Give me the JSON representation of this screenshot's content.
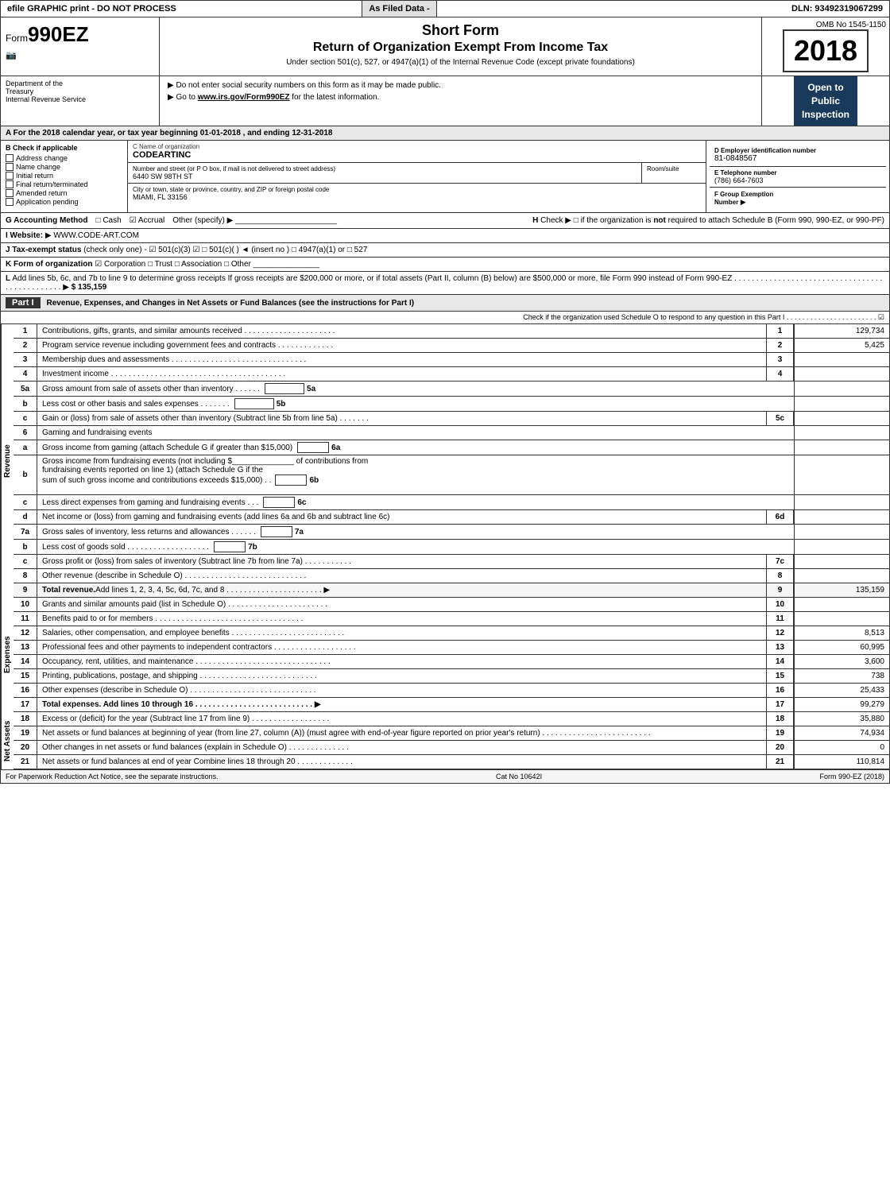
{
  "topBar": {
    "leftText": "efile GRAPHIC print - DO NOT PROCESS",
    "filedText": "As Filed Data -",
    "dlnLabel": "DLN: 93492319067299"
  },
  "header": {
    "ombNo": "OMB No 1545-1150",
    "year": "2018",
    "formLabel": "Form",
    "form990ez": "990EZ",
    "shortFormTitle": "Short Form",
    "returnTitle": "Return of Organization Exempt From Income Tax",
    "underSection": "Under section 501(c), 527, or 4947(a)(1) of the Internal Revenue Code (except private foundations)",
    "doNotEnter": "▶ Do not enter social security numbers on this form as it may be made public.",
    "goTo": "▶ Go to www.irs.gov/Form990EZ for the latest information.",
    "openTo": "Open to\nPublic\nInspection"
  },
  "orgInfo": {
    "deptLabel": "Department of the\nTreasury\nInternal Revenue Service",
    "sectionA": "A For the 2018 calendar year, or tax year beginning 01-01-2018   , and ending 12-31-2018",
    "checkIfApplicable": "B Check if applicable",
    "addressChange": "Address change",
    "nameChange": "Name change",
    "initialReturn": "Initial return",
    "finalReturn": "Final return/terminated",
    "amendedReturn": "Amended return",
    "applicationPending": "Application pending",
    "orgNameLabel": "C Name of organization",
    "orgName": "CODEARTINC",
    "streetLabel": "Number and street (or P O  box, if mail is not delivered to street address)",
    "streetValue": "6440 SW 98TH ST",
    "roomSuiteLabel": "Room/suite",
    "cityLabel": "City or town, state or province, country, and ZIP or foreign postal code",
    "cityValue": "MIAMI, FL  33156",
    "employerIdLabel": "D Employer identification number",
    "employerId": "81-0848567",
    "phoneLabel": "E Telephone number",
    "phone": "(786) 664-7603",
    "groupExemptLabel": "F Group Exemption\nNumber",
    "groupArrow": "▶"
  },
  "accounting": {
    "label": "G Accounting Method",
    "cash": "□ Cash",
    "accrual": "☑ Accrual",
    "other": "Other (specify) ▶",
    "hCheck": "H  Check ▶",
    "hCheckbox": "□",
    "hText": "if the organization is not required to attach Schedule B\n(Form 990, 990-EZ, or 990-PF)"
  },
  "website": {
    "label": "I Website:",
    "arrow": "▶",
    "url": "WWW.CODE-ART.COM"
  },
  "taxExempt": {
    "label": "J Tax-exempt status",
    "text": "(check only one) - ☑ 501(c)(3) ☑ □ 501(c)(  ) ◄ (insert no ) □ 4947(a)(1) or □ 527"
  },
  "formOrg": {
    "label": "K Form of organization",
    "corporation": "☑ Corporation",
    "trust": "□ Trust",
    "association": "□ Association",
    "other": "□ Other"
  },
  "addLines": {
    "text": "L Add lines 5b, 6c, and 7b to line 9 to determine gross receipts If gross receipts are $200,000 or more, or if total assets (Part II, column (B) below) are $500,000 or more, file Form 990 instead of Form 990-EZ",
    "dots": ". . . . . . . . . . . . . . . . . . . . . . . . . . . . . . . . . . . . . . . . . . . . . . .",
    "arrow": "▶",
    "value": "$ 135,159"
  },
  "partI": {
    "label": "Part I",
    "title": "Revenue, Expenses, and Changes in Net Assets or Fund Balances",
    "subtitle": "(see the instructions for Part I)",
    "scheduleOLine": "Check if the organization used Schedule O to respond to any question in this Part I . . . . . . . . . . . . . . . . . . . . . . . ☑",
    "rows": [
      {
        "num": "1",
        "desc": "Contributions, gifts, grants, and similar amounts received . . . . . . . . . . . . . . . . . . . . .",
        "boxNum": "1",
        "value": "129,734"
      },
      {
        "num": "2",
        "desc": "Program service revenue including government fees and contracts . . . . . . . . . . . . .",
        "boxNum": "2",
        "value": "5,425"
      },
      {
        "num": "3",
        "desc": "Membership dues and assessments . . . . . . . . . . . . . . . . . . . . . . . . . . . . . . .",
        "boxNum": "3",
        "value": ""
      },
      {
        "num": "4",
        "desc": "Investment income . . . . . . . . . . . . . . . . . . . . . . . . . . . . . . . . . . . . . . . .",
        "boxNum": "4",
        "value": ""
      }
    ],
    "row5a": {
      "num": "5a",
      "desc": "Gross amount from sale of assets other than inventory . . . . . .",
      "inlineLabel": "5a",
      "value": ""
    },
    "row5b": {
      "letter": "b",
      "desc": "Less  cost or other basis and sales expenses . . . . . . . .",
      "inlineLabel": "5b",
      "value": ""
    },
    "row5c": {
      "letter": "c",
      "desc": "Gain or (loss) from sale of assets other than inventory (Subtract line 5b from line 5a) . . . . . . .",
      "boxNum": "5c",
      "value": ""
    },
    "row6header": {
      "num": "6",
      "desc": "Gaming and fundraising events"
    },
    "row6a": {
      "letter": "a",
      "desc": "Gross income from gaming (attach Schedule G if greater than $15,000)",
      "inlineLabel": "6a",
      "value": ""
    },
    "row6b_text1": "Gross income from fundraising events (not including $",
    "row6b_text2": "of contributions from",
    "row6b_text3": "fundraising events reported on line 1) (attach Schedule G if the",
    "row6b_text4": "sum of such gross income and contributions exceeds $15,000)",
    "row6b_inlineLabel": "6b",
    "row6c": {
      "letter": "c",
      "desc": "Less  direct expenses from gaming and fundraising events",
      "inlineLabel": "6c",
      "value": ""
    },
    "row6d": {
      "letter": "d",
      "desc": "Net income or (loss) from gaming and fundraising events (add lines 6a and 6b and subtract line 6c)",
      "boxNum": "6d",
      "value": ""
    },
    "row7a": {
      "num": "7a",
      "desc": "Gross sales of inventory, less returns and allowances . . . . . .",
      "inlineLabel": "7a",
      "value": ""
    },
    "row7b": {
      "letter": "b",
      "desc": "Less  cost of goods sold           . . . . . . . . . . . . . . . . . . .",
      "inlineLabel": "7b",
      "value": ""
    },
    "row7c": {
      "letter": "c",
      "desc": "Gross profit or (loss) from sales of inventory (Subtract line 7b from line 7a) . . . . . . . . . . .",
      "boxNum": "7c",
      "value": ""
    },
    "row8": {
      "num": "8",
      "desc": "Other revenue (describe in Schedule O)        . . . . . . . . . . . . . . . . . . . . . . . . . . . . .",
      "boxNum": "8",
      "value": ""
    },
    "row9": {
      "num": "9",
      "desc": "Total revenue. Add lines 1, 2, 3, 4, 5c, 6d, 7c, and 8 . . . . . . . . . . . . . . . . . . . . . . ▶",
      "boxNum": "9",
      "value": "135,159",
      "bold": true
    },
    "rows_expenses": [
      {
        "num": "10",
        "desc": "Grants and similar amounts paid (list in Schedule O)     . . . . . . . . . . . . . . . . . . . . . . .",
        "boxNum": "10",
        "value": ""
      },
      {
        "num": "11",
        "desc": "Benefits paid to or for members         . . . . . . . . . . . . . . . . . . . . . . . . . . . . . . . . . .",
        "boxNum": "11",
        "value": ""
      },
      {
        "num": "12",
        "desc": "Salaries, other compensation, and employee benefits . . . . . . . . . . . . . . . . . . . . . . . . . .",
        "boxNum": "12",
        "value": "8,513"
      },
      {
        "num": "13",
        "desc": "Professional fees and other payments to independent contractors . . . . . . . . . . . . . . . . . . .",
        "boxNum": "13",
        "value": "60,995"
      },
      {
        "num": "14",
        "desc": "Occupancy, rent, utilities, and maintenance . . . . . . . . . . . . . . . . . . . . . . . . . . . . . . .",
        "boxNum": "14",
        "value": "3,600"
      },
      {
        "num": "15",
        "desc": "Printing, publications, postage, and shipping        . . . . . . . . . . . . . . . . . . . . . . . . . . .",
        "boxNum": "15",
        "value": "738"
      },
      {
        "num": "16",
        "desc": "Other expenses (describe in Schedule O)      . . . . . . . . . . . . . . . . . . . . . . . . . . . . .",
        "boxNum": "16",
        "value": "25,433"
      },
      {
        "num": "17",
        "desc": "Total expenses. Add lines 10 through 16     . . . . . . . . . . . . . . . . . . . . . . . . . . . ▶",
        "boxNum": "17",
        "value": "99,279",
        "bold": true
      }
    ],
    "rows_netassets": [
      {
        "num": "18",
        "desc": "Excess or (deficit) for the year (Subtract line 17 from line 9)     . . . . . . . . . . . . . . . . . .",
        "boxNum": "18",
        "value": "35,880"
      },
      {
        "num": "19",
        "desc": "Net assets or fund balances at beginning of year (from line 27, column (A)) (must agree with\nend-of-year figure reported on prior year's return)    . . . . . . . . . . . . . . . . . . . . . . . . .",
        "boxNum": "19",
        "value": "74,934"
      },
      {
        "num": "20",
        "desc": "Other changes in net assets or fund balances (explain in Schedule O)    . . . . . . . . . . . . . .",
        "boxNum": "20",
        "value": "0"
      },
      {
        "num": "21",
        "desc": "Net assets or fund balances at end of year  Combine lines 18 through 20  . . . . . . . . . . . . .",
        "boxNum": "21",
        "value": "110,814"
      }
    ]
  },
  "footer": {
    "leftText": "For Paperwork Reduction Act Notice, see the separate instructions.",
    "catNo": "Cat No 10642I",
    "rightText": "Form 990-EZ (2018)"
  }
}
